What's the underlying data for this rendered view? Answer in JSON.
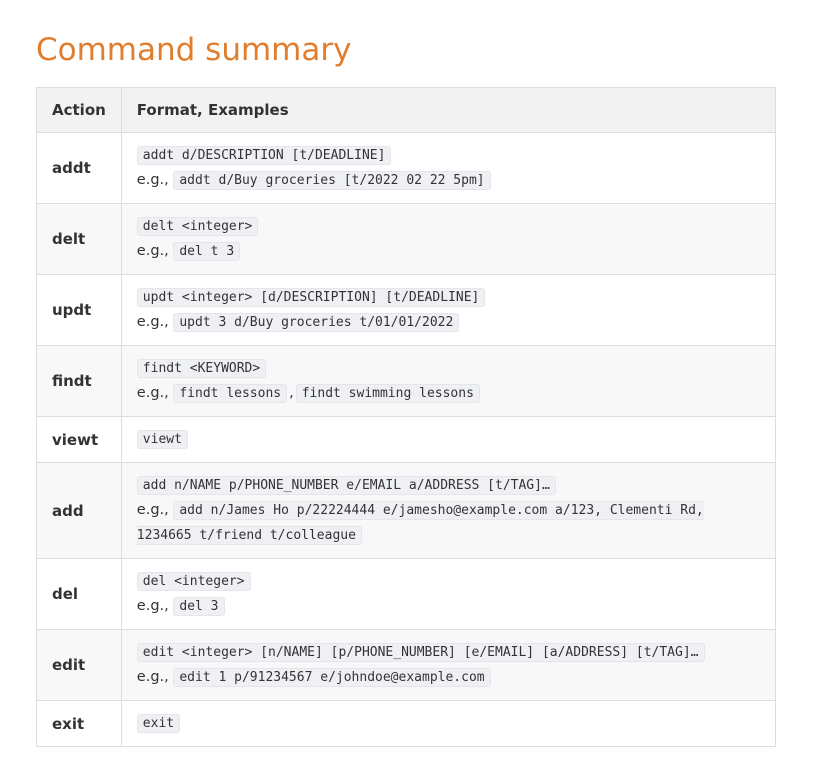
{
  "title": "Command summary",
  "table": {
    "headers": [
      "Action",
      "Format, Examples"
    ],
    "eg_label": "e.g.,",
    "rows": [
      {
        "action": "addt",
        "format": "addt d/DESCRIPTION [t/DEADLINE]",
        "examples": [
          "addt d/Buy groceries [t/2022 02 22 5pm]"
        ]
      },
      {
        "action": "delt",
        "format": "delt <integer>",
        "examples": [
          "del t 3"
        ]
      },
      {
        "action": "updt",
        "format": "updt <integer> [d/DESCRIPTION] [t/DEADLINE]",
        "examples": [
          "updt 3 d/Buy groceries t/01/01/2022"
        ]
      },
      {
        "action": "findt",
        "format": "findt <KEYWORD>",
        "examples": [
          "findt lessons",
          "findt swimming lessons"
        ]
      },
      {
        "action": "viewt",
        "format": "viewt",
        "examples": []
      },
      {
        "action": "add",
        "format": "add n/NAME p/PHONE_NUMBER e/EMAIL a/ADDRESS [t/TAG]…",
        "examples": [
          "add n/James Ho p/22224444 e/jamesho@example.com a/123, Clementi Rd, 1234665 t/friend t/colleague"
        ]
      },
      {
        "action": "del",
        "format": "del <integer>",
        "examples": [
          "del 3"
        ]
      },
      {
        "action": "edit",
        "format": "edit <integer> [n/NAME] [p/PHONE_NUMBER] [e/EMAIL] [a/ADDRESS] [t/TAG]…",
        "examples": [
          "edit 1 p/91234567 e/johndoe@example.com"
        ]
      },
      {
        "action": "exit",
        "format": "exit",
        "examples": []
      }
    ]
  }
}
